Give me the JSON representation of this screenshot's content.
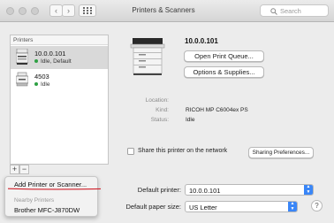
{
  "window": {
    "title": "Printers & Scanners",
    "search_placeholder": "Search"
  },
  "printers_header": "Printers",
  "printers": [
    {
      "name": "10.0.0.101",
      "status": "Idle, Default",
      "selected": true
    },
    {
      "name": "4503",
      "status": "Idle",
      "selected": false
    }
  ],
  "list_controls": {
    "add": "+",
    "remove": "−"
  },
  "detail": {
    "device_name": "10.0.0.101",
    "open_queue_label": "Open Print Queue...",
    "options_label": "Options & Supplies...",
    "location_label": "Location:",
    "location_value": "",
    "kind_label": "Kind:",
    "kind_value": "RICOH MP C6004ex PS",
    "status_label": "Status:",
    "status_value": "Idle",
    "share_label": "Share this printer on the network",
    "share_checked": false,
    "sharing_prefs_label": "Sharing Preferences..."
  },
  "defaults": {
    "default_printer_label": "Default printer:",
    "default_printer_value": "10.0.0.101",
    "paper_size_label": "Default paper size:",
    "paper_size_value": "US Letter"
  },
  "popup_menu": {
    "add_item": "Add Printer or Scanner...",
    "nearby_header": "Nearby Printers",
    "nearby_items": [
      "Brother MFC-J870DW"
    ]
  },
  "colors": {
    "accent": "#3a86f7",
    "status_idle": "#2ea043",
    "annotation": "#d0202a"
  }
}
